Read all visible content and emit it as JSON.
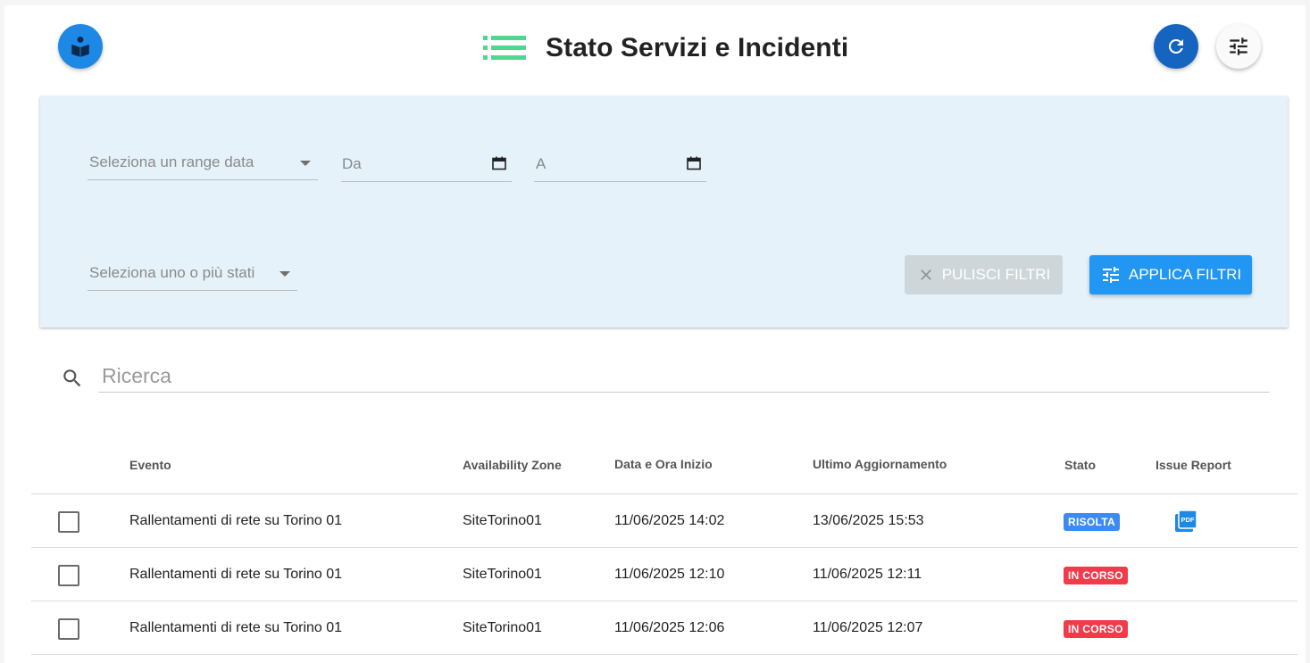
{
  "header": {
    "title": "Stato Servizi e Incidenti",
    "accent_color": "#1e88e5",
    "title_icon_color": "#4cd98f"
  },
  "filters": {
    "date_range_placeholder": "Seleziona un range data",
    "from_placeholder": "Da",
    "to_placeholder": "A",
    "status_placeholder": "Seleziona uno o più stati",
    "clear_label": "PULISCI FILTRI",
    "apply_label": "APPLICA FILTRI"
  },
  "search": {
    "placeholder": "Ricerca"
  },
  "table": {
    "columns": [
      "Evento",
      "Availability Zone",
      "Data e Ora Inizio",
      "Ultimo Aggiornamento",
      "Stato",
      "Issue Report"
    ],
    "rows": [
      {
        "evento": "Rallentamenti di rete su Torino 01",
        "zone": "SiteTorino01",
        "start": "11/06/2025 14:02",
        "updated": "13/06/2025 15:53",
        "status": "RISOLTA",
        "status_color": "#3d8bf2",
        "has_report": true
      },
      {
        "evento": "Rallentamenti di rete su Torino 01",
        "zone": "SiteTorino01",
        "start": "11/06/2025 12:10",
        "updated": "11/06/2025 12:11",
        "status": "IN CORSO",
        "status_color": "#f23a4a",
        "has_report": false
      },
      {
        "evento": "Rallentamenti di rete su Torino 01",
        "zone": "SiteTorino01",
        "start": "11/06/2025 12:06",
        "updated": "11/06/2025 12:07",
        "status": "IN CORSO",
        "status_color": "#f23a4a",
        "has_report": false
      }
    ]
  },
  "icons": {
    "logo": "book-reader-icon",
    "title": "list-icon",
    "refresh": "refresh-icon",
    "tune": "tune-icon",
    "clear": "close-icon",
    "apply": "tune-icon",
    "search": "search-icon",
    "report": "pdf-icon"
  }
}
